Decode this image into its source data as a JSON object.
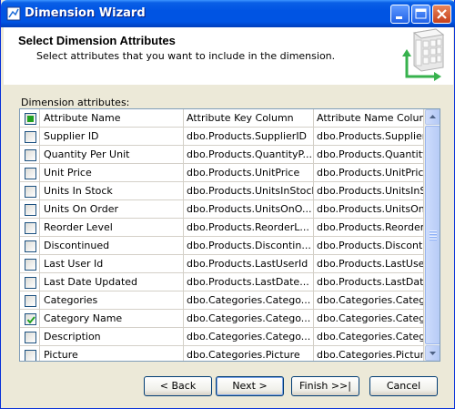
{
  "window": {
    "title": "Dimension Wizard"
  },
  "header": {
    "title": "Select Dimension Attributes",
    "subtitle": "Select attributes that you want to include in the dimension."
  },
  "group_label": "Dimension attributes:",
  "table": {
    "columns": [
      "Attribute Name",
      "Attribute Key Column",
      "Attribute Name Column"
    ],
    "header_check_state": "partial",
    "rows": [
      {
        "checked": false,
        "name": "Supplier ID",
        "key": "dbo.Products.SupplierID",
        "namecol": "dbo.Products.SupplierID"
      },
      {
        "checked": false,
        "name": "Quantity Per Unit",
        "key": "dbo.Products.QuantityP...",
        "namecol": "dbo.Products.QuantityP..."
      },
      {
        "checked": false,
        "name": "Unit Price",
        "key": "dbo.Products.UnitPrice",
        "namecol": "dbo.Products.UnitPrice"
      },
      {
        "checked": false,
        "name": "Units In Stock",
        "key": "dbo.Products.UnitsInStock",
        "namecol": "dbo.Products.UnitsInStock"
      },
      {
        "checked": false,
        "name": "Units On Order",
        "key": "dbo.Products.UnitsOnO...",
        "namecol": "dbo.Products.UnitsOnO..."
      },
      {
        "checked": false,
        "name": "Reorder Level",
        "key": "dbo.Products.ReorderL...",
        "namecol": "dbo.Products.ReorderL..."
      },
      {
        "checked": false,
        "name": "Discontinued",
        "key": "dbo.Products.Discontin...",
        "namecol": "dbo.Products.Discontin..."
      },
      {
        "checked": false,
        "name": "Last User Id",
        "key": "dbo.Products.LastUserId",
        "namecol": "dbo.Products.LastUserId"
      },
      {
        "checked": false,
        "name": "Last Date Updated",
        "key": "dbo.Products.LastDate...",
        "namecol": "dbo.Products.LastDate..."
      },
      {
        "checked": false,
        "name": "Categories",
        "key": "dbo.Categories.Catego...",
        "namecol": "dbo.Categories.Catego..."
      },
      {
        "checked": true,
        "name": "Category Name",
        "key": "dbo.Categories.Catego...",
        "namecol": "dbo.Categories.Catego..."
      },
      {
        "checked": false,
        "name": "Description",
        "key": "dbo.Categories.Catego...",
        "namecol": "dbo.Categories.Catego..."
      },
      {
        "checked": false,
        "name": "Picture",
        "key": "dbo.Categories.Picture",
        "namecol": "dbo.Categories.Picture"
      }
    ]
  },
  "buttons": {
    "back": "< Back",
    "next": "Next >",
    "finish": "Finish >>|",
    "cancel": "Cancel"
  },
  "colors": {
    "titlebar": "#0054e3",
    "dialog_bg": "#ece9d8",
    "check_green": "#21a121"
  }
}
